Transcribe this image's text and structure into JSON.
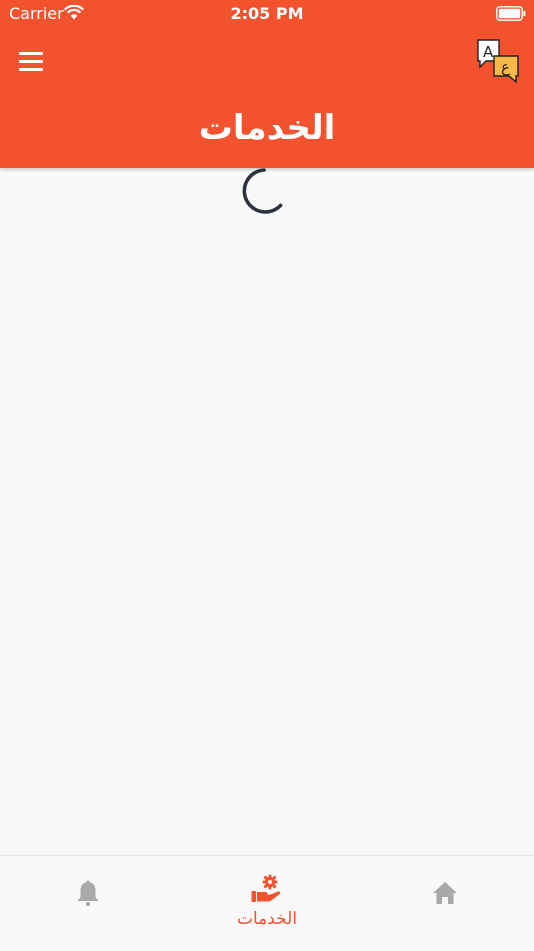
{
  "status_bar": {
    "carrier": "Carrier",
    "time": "2:05 PM"
  },
  "header": {
    "title": "الخدمات",
    "background_color": "#f2522e",
    "menu_icon": "hamburger-menu-icon",
    "language_icon": "language-switch-icon",
    "language_icon_letters": [
      "A",
      "ع"
    ]
  },
  "main": {
    "loading_indicator": "spinner-icon"
  },
  "tabbar": {
    "active_color": "#f2522e",
    "inactive_color": "#a9a9a9",
    "tabs": [
      {
        "id": "notifications",
        "icon": "bell-icon",
        "label": "",
        "active": false
      },
      {
        "id": "services",
        "icon": "hand-gear-icon",
        "label": "الخدمات",
        "active": true
      },
      {
        "id": "home",
        "icon": "home-icon",
        "label": "",
        "active": false
      }
    ]
  }
}
